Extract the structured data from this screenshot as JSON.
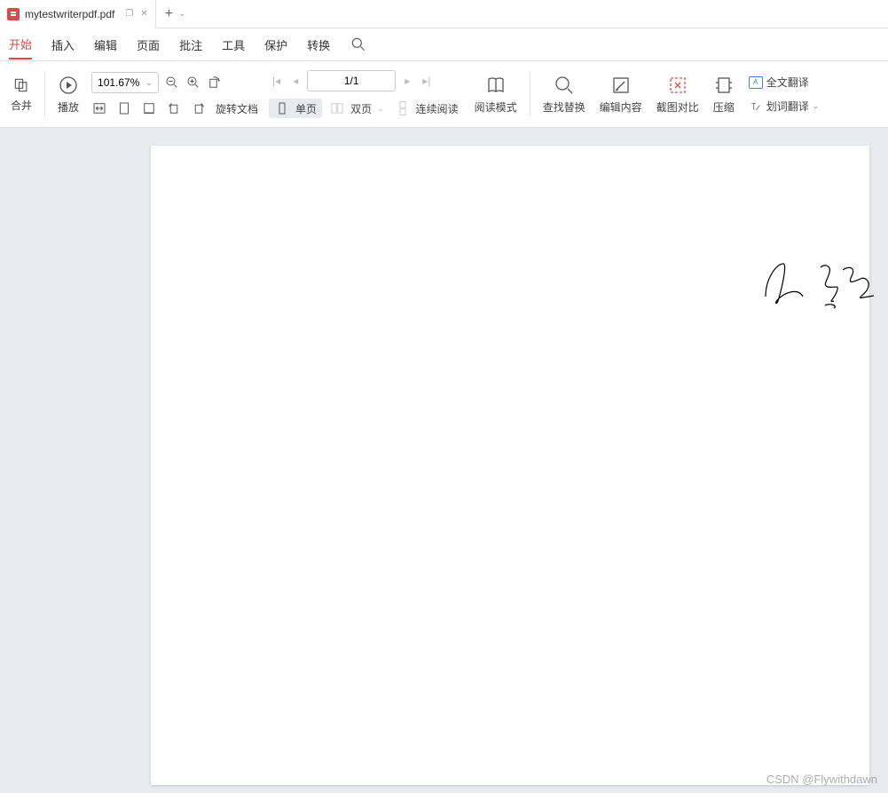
{
  "tab": {
    "title": "mytestwriterpdf.pdf"
  },
  "menu": {
    "items": [
      "开始",
      "插入",
      "编辑",
      "页面",
      "批注",
      "工具",
      "保护",
      "转换"
    ],
    "active_index": 0
  },
  "toolbar": {
    "merge": "合并",
    "play": "播放",
    "zoom_value": "101.67%",
    "page_value": "1/1",
    "rotate_doc": "旋转文档",
    "single_page": "单页",
    "double_page": "双页",
    "continuous": "连续阅读",
    "reading_mode": "阅读模式",
    "find_replace": "查找替换",
    "edit_content": "编辑内容",
    "screenshot_compare": "截图对比",
    "compress": "压缩",
    "full_translate": "全文翻译",
    "word_translate": "划词翻译"
  },
  "watermark": "CSDN @Flywithdawn"
}
